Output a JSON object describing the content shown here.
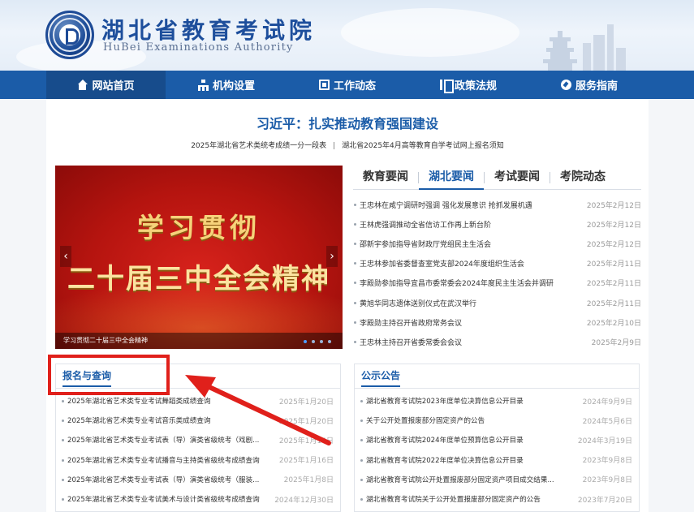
{
  "header": {
    "title_cn": "湖北省教育考试院",
    "title_en": "HuBei Examinations Authority",
    "emblem_text": "湖北省教育考试院"
  },
  "nav": {
    "items": [
      {
        "label": "网站首页",
        "icon": "home-icon"
      },
      {
        "label": "机构设置",
        "icon": "org-icon"
      },
      {
        "label": "工作动态",
        "icon": "news-icon"
      },
      {
        "label": "政策法规",
        "icon": "policy-icon"
      },
      {
        "label": "服务指南",
        "icon": "guide-icon"
      }
    ]
  },
  "headline": "习近平：扎实推动教育强国建设",
  "sublinks": [
    "2025年湖北省艺术类统考成绩一分一段表",
    "湖北省2025年4月高等教育自学考试网上报名须知"
  ],
  "slider": {
    "line1": "学习贯彻",
    "line2": "二十届三中全会精神",
    "caption": "学习贯彻二十届三中全会精神",
    "prev": "‹",
    "next": "›"
  },
  "news_tabs": {
    "tabs": [
      "教育要闻",
      "湖北要闻",
      "考试要闻",
      "考院动态"
    ],
    "items": [
      {
        "title": "王忠林在咸宁调研时强调 强化发展意识 抢抓发展机遇",
        "date": "2025年2月12日"
      },
      {
        "title": "王林虎强调推动全省信访工作再上新台阶",
        "date": "2025年2月12日"
      },
      {
        "title": "邵新宇参加指导省财政厅党组民主生活会",
        "date": "2025年2月12日"
      },
      {
        "title": "王忠林参加省委督查室党支部2024年度组织生活会",
        "date": "2025年2月11日"
      },
      {
        "title": "李殿勋参加指导宜昌市委常委会2024年度民主生活会并调研",
        "date": "2025年2月11日"
      },
      {
        "title": "黄旭华同志遗体送别仪式在武汉举行",
        "date": "2025年2月11日"
      },
      {
        "title": "李殿勋主持召开省政府常务会议",
        "date": "2025年2月10日"
      },
      {
        "title": "王忠林主持召开省委常委会会议",
        "date": "2025年2月9日"
      }
    ]
  },
  "registration": {
    "title": "报名与查询",
    "items": [
      {
        "title": "2025年湖北省艺术类专业考试舞蹈类成绩查询",
        "date": "2025年1月20日"
      },
      {
        "title": "2025年湖北省艺术类专业考试音乐类成绩查询",
        "date": "2025年1月20日"
      },
      {
        "title": "2025年湖北省艺术类专业考试表（导）演类省级统考（戏剧...",
        "date": "2025年1月16日"
      },
      {
        "title": "2025年湖北省艺术类专业考试播音与主持类省级统考成绩查询",
        "date": "2025年1月16日"
      },
      {
        "title": "2025年湖北省艺术类专业考试表（导）演类省级统考（服装...",
        "date": "2025年1月8日"
      },
      {
        "title": "2025年湖北省艺术类专业考试美术与设计类省级统考成绩查询",
        "date": "2024年12月30日"
      }
    ]
  },
  "announcements": {
    "title": "公示公告",
    "items": [
      {
        "title": "湖北省教育考试院2023年度单位决算信息公开目录",
        "date": "2024年9月9日"
      },
      {
        "title": "关于公开处置报废部分固定资产的公告",
        "date": "2024年5月6日"
      },
      {
        "title": "湖北省教育考试院2024年度单位预算信息公开目录",
        "date": "2024年3月19日"
      },
      {
        "title": "湖北省教育考试院2022年度单位决算信息公开目录",
        "date": "2023年9月8日"
      },
      {
        "title": "湖北省教育考试院公开处置报废部分固定资产项目成交结果...",
        "date": "2023年9月8日"
      },
      {
        "title": "湖北省教育考试院关于公开处置报废部分固定资产的公告",
        "date": "2023年7月20日"
      }
    ]
  },
  "colors": {
    "primary": "#1b5ca8",
    "annotation": "#e0201b",
    "banner_red": "#c41a14"
  }
}
